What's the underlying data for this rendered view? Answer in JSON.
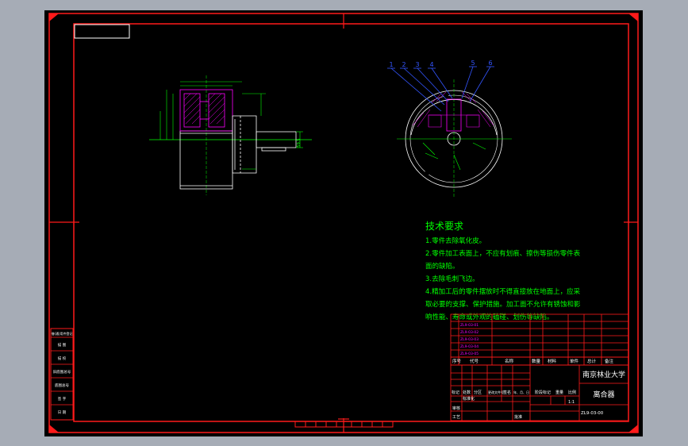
{
  "tech": {
    "heading": "技术要求",
    "line1": "1.零件去除氧化皮。",
    "line2": "2.零件加工表面上，不应有划痕、擦伤等损伤零件表",
    "line3": "面的缺陷。",
    "line4": "3.去除毛刺飞边。",
    "line5": "4.精加工后的零件摆放时不得直接放在地面上，应采",
    "line6": "取必要的支撑、保护措施。加工面不允许有锈蚀和影",
    "line7": "响性能、寿命或外观的磕碰、划伤等缺陷。"
  },
  "views": {
    "balloons": [
      "1",
      "2",
      "3",
      "4",
      "5",
      "6"
    ],
    "side_dim": "59.5"
  },
  "title_block": {
    "university": "南京林业大学",
    "drawing_name": "离合器",
    "drawing_number": "ZL9-03-00",
    "scale": "1:1",
    "col_labels": [
      "序号",
      "代号",
      "名称",
      "数量",
      "材料",
      "单件",
      "总计",
      "备注"
    ],
    "approve": "审核",
    "process": "工艺",
    "standard": "标准化",
    "approval": "批准",
    "mark_labels": [
      "标记",
      "处数",
      "分区",
      "更改文件号",
      "签名",
      "年、月、日"
    ],
    "stage_labels": [
      "阶段标记",
      "重量",
      "比例"
    ]
  },
  "left_strip": [
    "借(通)用件登记",
    "描 图",
    "描 校",
    "旧底图总号",
    "底图总号",
    "签 字",
    "日 期"
  ],
  "colors": {
    "frame": "#ff0000",
    "text": "#00ff00",
    "geometry": "#ffffff",
    "parts": "#ff00ff",
    "balloon": "#3355ff",
    "bom_text": "#ff00ff",
    "background": "#000000"
  }
}
